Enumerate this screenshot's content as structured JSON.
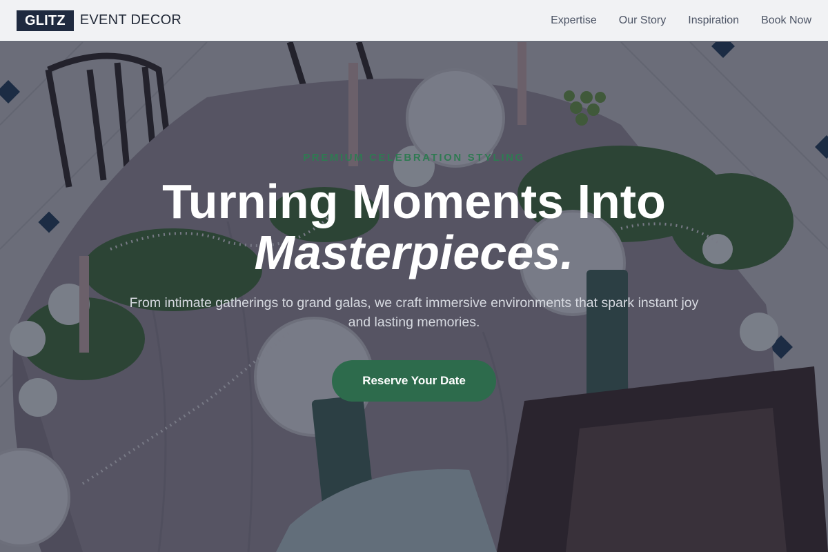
{
  "header": {
    "logo_box": "GLITZ",
    "logo_text": "EVENT DECOR",
    "nav": [
      {
        "label": "Expertise"
      },
      {
        "label": "Our Story"
      },
      {
        "label": "Inspiration"
      },
      {
        "label": "Book Now"
      }
    ]
  },
  "hero": {
    "eyebrow": "PREMIUM CELEBRATION STYLING",
    "headline_line1": "Turning Moments Into",
    "headline_line2": "Masterpieces.",
    "subtitle": "From intimate gatherings to grand galas, we craft immersive environments that spark instant joy and lasting memories.",
    "cta_label": "Reserve Your Date"
  },
  "colors": {
    "header_bg": "#f1f2f4",
    "logo_bg": "#1f2a3f",
    "accent_green": "#2d6b4c",
    "eyebrow_green": "#2f7a52",
    "overlay": "#1e243a"
  }
}
